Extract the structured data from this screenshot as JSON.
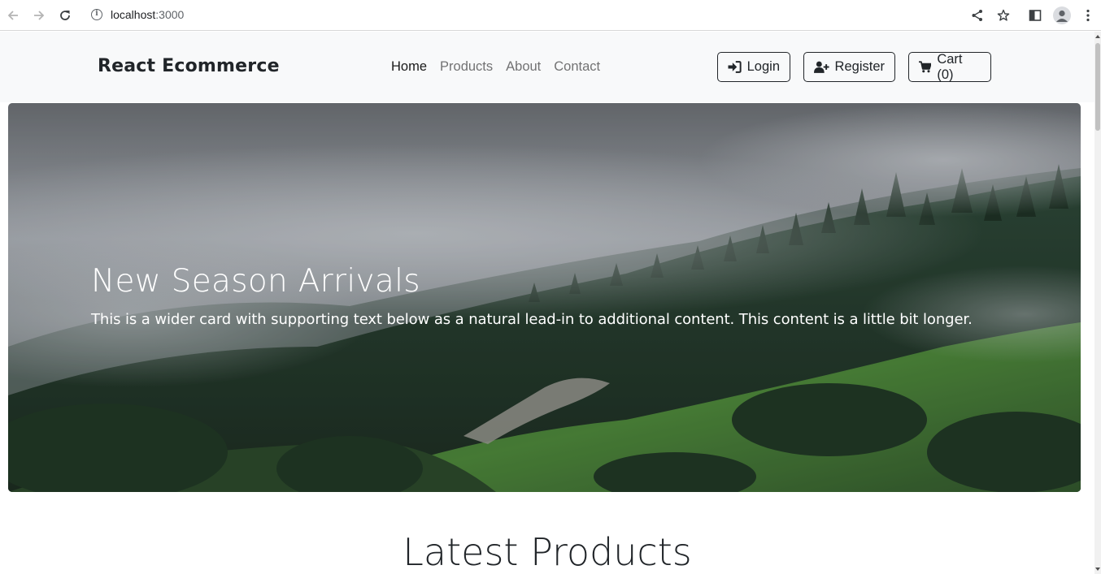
{
  "browser": {
    "url_host": "localhost",
    "url_port": ":3000",
    "icons": [
      "back-arrow-icon",
      "forward-arrow-icon",
      "reload-icon",
      "info-icon",
      "share-icon",
      "star-icon",
      "side-panel-icon",
      "profile-icon",
      "menu-dots-icon"
    ]
  },
  "navbar": {
    "brand": "React Ecommerce",
    "links": [
      {
        "label": "Home",
        "active": true
      },
      {
        "label": "Products",
        "active": false
      },
      {
        "label": "About",
        "active": false
      },
      {
        "label": "Contact",
        "active": false
      }
    ],
    "buttons": {
      "login": "Login",
      "register": "Register",
      "cart": "Cart (0)"
    }
  },
  "hero": {
    "title": "New Season Arrivals",
    "text": "This is a wider card with supporting text below as a natural lead-in to additional content. This content is a little bit longer."
  },
  "section": {
    "title": "Latest Products"
  },
  "colors": {
    "navbar_bg": "#f8f9fa",
    "text_dark": "#212529"
  }
}
